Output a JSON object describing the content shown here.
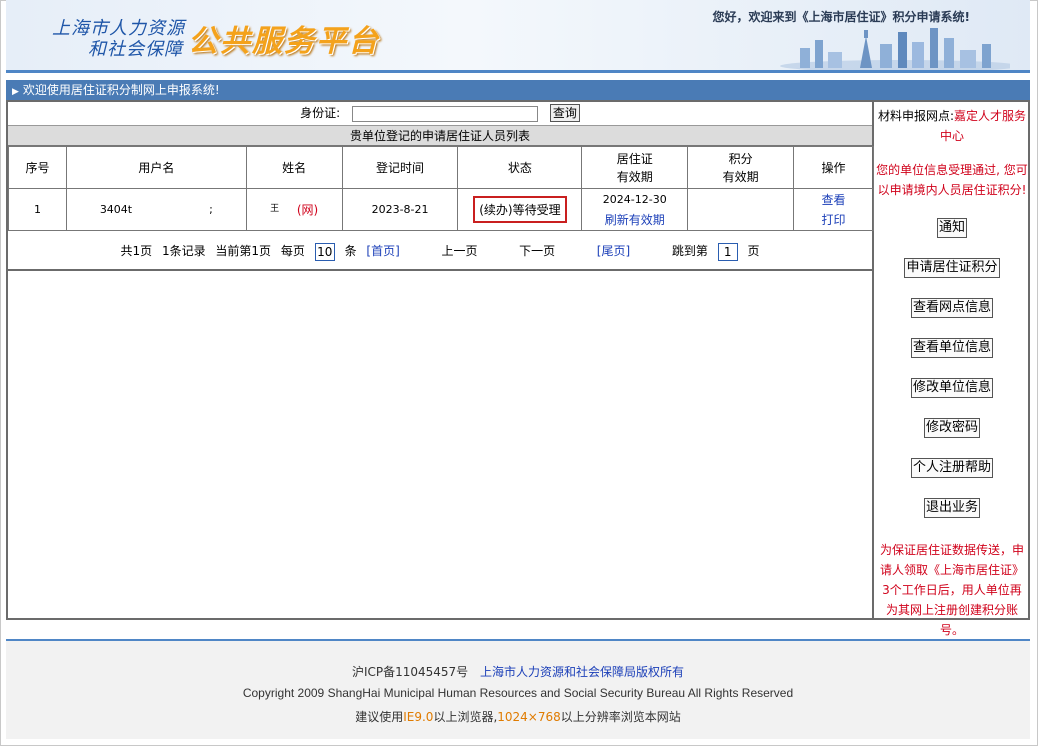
{
  "header": {
    "logo_line1": "上海市人力资源",
    "logo_line2": "和社会保障",
    "logo_platform": "公共服务平台",
    "welcome_banner": "您好，欢迎来到《上海市居住证》积分申请系统!"
  },
  "titlebar": {
    "text": "欢迎使用居住证积分制网上申报系统!"
  },
  "search": {
    "id_label": "身份证:",
    "id_value": "",
    "query_button": "查询"
  },
  "list_title": "贵单位登记的申请居住证人员列表",
  "table": {
    "headers": {
      "seq": "序号",
      "username": "用户名",
      "name": "姓名",
      "register_time": "登记时间",
      "status": "状态",
      "permit_validity_l1": "居住证",
      "permit_validity_l2": "有效期",
      "points_validity_l1": "积分",
      "points_validity_l2": "有效期",
      "action": "操作"
    },
    "rows": [
      {
        "seq": "1",
        "username": "3404t",
        "username_tail": ";",
        "name": "王",
        "name_tag": "(网)",
        "register_time": "2023-8-21",
        "status": "(续办)等待受理",
        "permit_date": "2024-12-30",
        "refresh_link": "刷新有效期",
        "points_validity": "",
        "view_link": "查看",
        "print_link": "打印"
      }
    ]
  },
  "pager": {
    "total_pages": "共1页",
    "total_records": "1条记录",
    "current_page": "当前第1页",
    "per_page_label": "每页",
    "per_page_value": "10",
    "per_page_unit": "条",
    "first": "[首页]",
    "prev": "上一页",
    "next": "下一页",
    "last": "[尾页]",
    "jump_label": "跳到第",
    "jump_value": "1",
    "jump_unit": "页"
  },
  "sidebar": {
    "material_label": "材料申报网点:",
    "material_value": "嘉定人才服务中心",
    "info_notice": "您的单位信息受理通过, 您可以申请境内人员居住证积分!",
    "buttons": {
      "notice": "通知",
      "apply": "申请居住证积分",
      "view_site": "查看网点信息",
      "view_unit": "查看单位信息",
      "edit_unit": "修改单位信息",
      "change_password": "修改密码",
      "register_help": "个人注册帮助",
      "logout": "退出业务"
    },
    "bottom_notice": "为保证居住证数据传送，申请人领取《上海市居住证》3个工作日后，用人单位再为其网上注册创建积分账号。"
  },
  "footer": {
    "icp": "沪ICP备11045457号",
    "copyright_cn": "上海市人力资源和社会保障局版权所有",
    "copyright_en": "Copyright 2009 ShangHai Municipal Human Resources and Social Security Bureau All Rights Reserved",
    "suggest_prefix": "建议使用",
    "browser": "IE9.0",
    "suggest_mid": "以上浏览器,",
    "resolution": "1024×768",
    "suggest_suffix": "以上分辨率浏览本网站"
  },
  "colors": {
    "brand_blue": "#1f56a8",
    "title_bar": "#4a7bb5",
    "platform_orange": "#f4a21b",
    "alert_red": "#d0021b",
    "link_blue": "#1b3fb8"
  }
}
